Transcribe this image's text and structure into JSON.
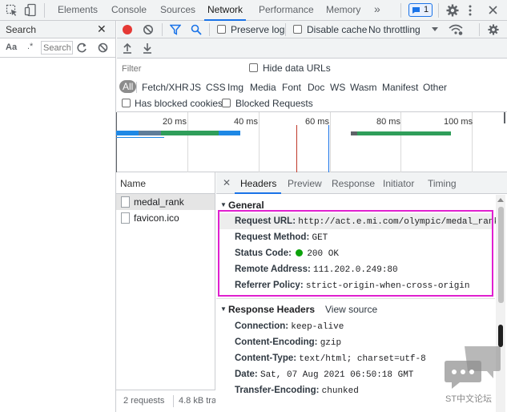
{
  "top_tabs": {
    "items": [
      {
        "label": "Elements"
      },
      {
        "label": "Console"
      },
      {
        "label": "Sources"
      },
      {
        "label": "Network",
        "active": true
      },
      {
        "label": "Performance"
      },
      {
        "label": "Memory"
      }
    ],
    "more": "»",
    "issues_badge": "1",
    "accent": "#1a73e8"
  },
  "search_panel": {
    "title": "Search",
    "close": "✕",
    "aa": "Aa",
    "regex": ".*",
    "placeholder": "Search"
  },
  "network_toolbar": {
    "preserve_log": "Preserve log",
    "disable_cache": "Disable cache",
    "throttling": "No throttling",
    "record_color": "#e53935"
  },
  "filter": {
    "placeholder": "Filter",
    "hide_data_urls": "Hide data URLs",
    "types": [
      "All",
      "Fetch/XHR",
      "JS",
      "CSS",
      "Img",
      "Media",
      "Font",
      "Doc",
      "WS",
      "Wasm",
      "Manifest",
      "Other"
    ],
    "has_blocked_cookies": "Has blocked cookies",
    "blocked_requests": "Blocked Requests"
  },
  "timeline": {
    "ticks": [
      "20 ms",
      "40 ms",
      "60 ms",
      "80 ms",
      "100 ms"
    ]
  },
  "request_list": {
    "column": "Name",
    "rows": [
      {
        "name": "medal_rank",
        "selected": true
      },
      {
        "name": "favicon.ico",
        "selected": false
      }
    ],
    "status_requests": "2 requests",
    "status_size": "4.8 kB tra"
  },
  "detail": {
    "close": "✕",
    "tabs": [
      "Headers",
      "Preview",
      "Response",
      "Initiator",
      "Timing"
    ],
    "general_title": "General",
    "general": [
      {
        "key": "Request URL:",
        "value": "http://act.e.mi.com/olympic/medal_rank"
      },
      {
        "key": "Request Method:",
        "value": "GET"
      },
      {
        "key": "Status Code:",
        "value": "200 OK"
      },
      {
        "key": "Remote Address:",
        "value": "111.202.0.249:80"
      },
      {
        "key": "Referrer Policy:",
        "value": "strict-origin-when-cross-origin"
      }
    ],
    "response_title": "Response Headers",
    "view_source": "View source",
    "response": [
      {
        "key": "Connection:",
        "value": "keep-alive"
      },
      {
        "key": "Content-Encoding:",
        "value": "gzip"
      },
      {
        "key": "Content-Type:",
        "value": "text/html; charset=utf-8"
      },
      {
        "key": "Date:",
        "value": "Sat, 07 Aug 2021 06:50:18 GMT"
      },
      {
        "key": "Transfer-Encoding:",
        "value": "chunked"
      }
    ],
    "highlight_color": "#e020d0",
    "status_dot_color": "#0ca20c"
  },
  "watermark": {
    "text": "ST中文论坛"
  }
}
